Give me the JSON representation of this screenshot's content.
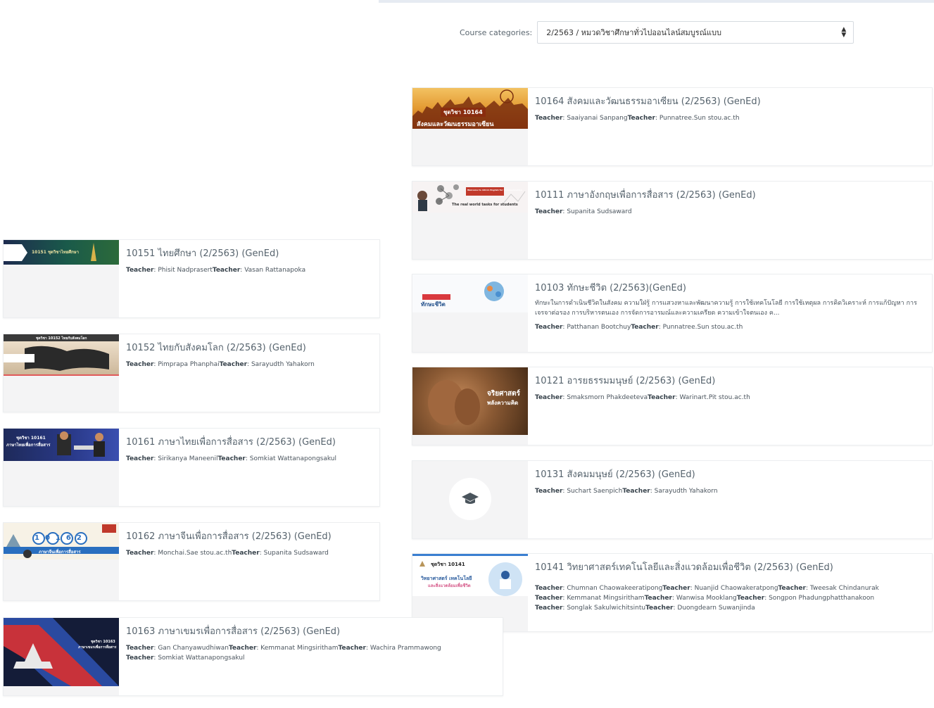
{
  "filter": {
    "label": "Course categories:",
    "selected": "2/2563 / หมวดวิชาศึกษาทั่วไปออนไลน์สมบูรณ์แบบ"
  },
  "colors": {
    "title_link": "#56636d",
    "card_border": "#eceef0",
    "thumb_bg": "#f4f4f5"
  },
  "teacher_label": "Teacher",
  "courses": [
    {
      "title": "10164 สังคมและวัฒนธรรมอาเซียน (2/2563) (GenEd)",
      "teachers": [
        "Saaiyanai Sanpang",
        "Punnatree.Sun stou.ac.th"
      ],
      "image_text": [
        "ชุดวิชา 10164",
        "สังคมและวัฒนธรรมอาเซียน"
      ]
    },
    {
      "title": "10111 ภาษาอังกฤษเพื่อการสื่อสาร (2/2563) (GenEd)",
      "teachers": [
        "Supanita Sudsaward"
      ],
      "image_text": [
        "Welcome to 10111 English for Communication",
        "The real world tasks for students"
      ]
    },
    {
      "title": "10103 ทักษะชีวิต (2/2563)(GenEd)",
      "summary": "ทักษะในการดำเนินชีวิตในสังคม ความใฝ่รู้ การแสวงหาและพัฒนาความรู้ การใช้เทคโนโลยี การใช้เหตุผล การคิดวิเคราะห์ การแก้ปัญหา การเจรจาต่อรอง การบริหารตนเอง การจัดการอารมณ์และความเครียด ความเข้าใจตนเอง ค...",
      "teachers": [
        "Patthanan Bootchuy",
        "Punnatree.Sun stou.ac.th"
      ],
      "image_text": [
        "ทักษะชีวิต"
      ]
    },
    {
      "title": "10121 อารยธรรมมนุษย์ (2/2563) (GenEd)",
      "teachers": [
        "Smaksmorn Phakdeeteva",
        "Warinart.Pit stou.ac.th"
      ],
      "image_text": [
        "จริยศาสตร์",
        "พลังความคิด"
      ]
    },
    {
      "title": "10131 สังคมมนุษย์ (2/2563) (GenEd)",
      "teachers": [
        "Suchart Saenpich",
        "Sarayudth Yahakorn"
      ]
    },
    {
      "title": "10141 วิทยาศาสตร์เทคโนโลยีและสิ่งแวดล้อมเพื่อชีวิต (2/2563) (GenEd)",
      "teachers": [
        "Chumnan Chaowakeeratipong",
        "Nuanjid Chaowakeratpong",
        "Tweesak Chindanurak",
        "Kemmanat Mingsiritham",
        "Wanwisa Mooklang",
        "Songpon Phadungphatthanakoon",
        "Songlak Sakulwichitsintu",
        "Duongdearn Suwanjinda"
      ],
      "image_text": [
        "ชุดวิชา 10141",
        "วิทยาศาสตร์ เทคโนโลยี",
        "และสิ่งแวดล้อมเพื่อชีวิต"
      ]
    },
    {
      "title": "10151 ไทยศึกษา (2/2563) (GenEd)",
      "teachers": [
        "Phisit Nadprasert",
        "Vasan Rattanapoka"
      ],
      "image_text": [
        "10151 ชุดวิชาไทยศึกษา"
      ]
    },
    {
      "title": "10152 ไทยกับสังคมโลก (2/2563) (GenEd)",
      "teachers": [
        "Pimprapa Phanphai",
        "Sarayudth Yahakorn"
      ],
      "image_text": [
        "ชุดวิชา 10152 ไทยกับสังคมโลก"
      ]
    },
    {
      "title": "10161 ภาษาไทยเพื่อการสื่อสาร (2/2563) (GenEd)",
      "teachers": [
        "Sirikanya Maneenil",
        "Somkiat Wattanapongsakul"
      ],
      "image_text": [
        "ชุดวิชา 10161",
        "ภาษาไทยเพื่อการสื่อสาร"
      ]
    },
    {
      "title": "10162 ภาษาจีนเพื่อการสื่อสาร (2/2563) (GenEd)",
      "teachers": [
        "Monchai.Sae stou.ac.th",
        "Supanita Sudsaward"
      ],
      "image_text": [
        "10162",
        "ภาษาจีนเพื่อการสื่อสาร"
      ]
    },
    {
      "title": "10163 ภาษาเขมรเพื่อการสื่อสาร (2/2563) (GenEd)",
      "teachers": [
        "Gan Chanyawudhiwan",
        "Kemmanat Mingsiritham",
        "Wachira Prammawong",
        "Somkiat Wattanapongsakul"
      ],
      "image_text": [
        "ชุดวิชา 10163",
        "ภาษาเขมรเพื่อการสื่อสาร"
      ]
    }
  ]
}
